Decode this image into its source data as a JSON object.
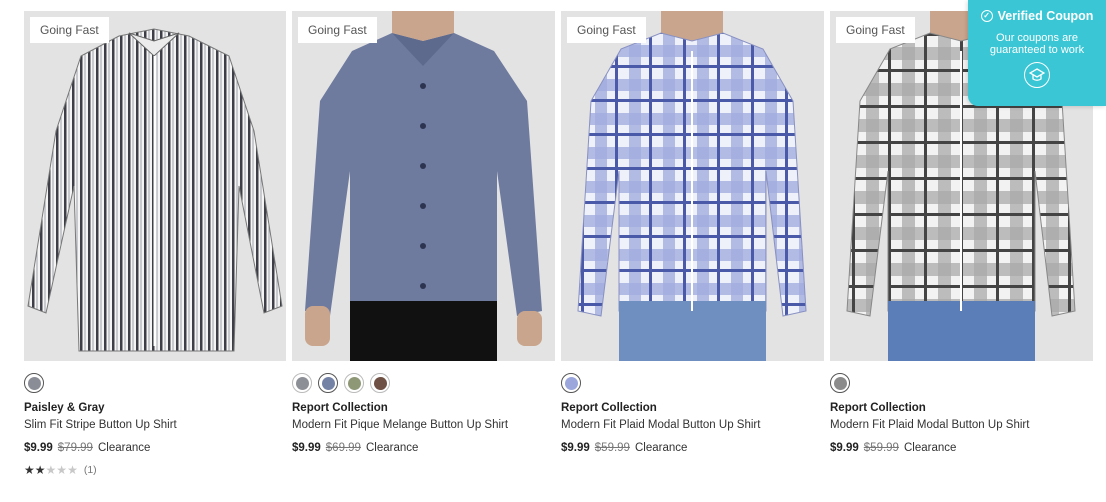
{
  "coupon": {
    "title": "Verified Coupon",
    "line1": "Our coupons are",
    "line2": "guaranteed to work"
  },
  "products": [
    {
      "badge": "Going Fast",
      "brand": "Paisley & Gray",
      "name": "Slim Fit Stripe Button Up Shirt",
      "price": "$9.99",
      "original_price": "$79.99",
      "status": "Clearance",
      "rating": 2,
      "rating_max": 5,
      "rating_count": "(1)",
      "swatches": [
        {
          "color": "#8a8d96",
          "selected": true
        }
      ]
    },
    {
      "badge": "Going Fast",
      "brand": "Report Collection",
      "name": "Modern Fit Pique Melange Button Up Shirt",
      "price": "$9.99",
      "original_price": "$69.99",
      "status": "Clearance",
      "swatches": [
        {
          "color": "#8d8f96",
          "selected": false
        },
        {
          "color": "#7482a6",
          "selected": true
        },
        {
          "color": "#8e9877",
          "selected": false
        },
        {
          "color": "#6e5044",
          "selected": false
        }
      ]
    },
    {
      "badge": "Going Fast",
      "brand": "Report Collection",
      "name": "Modern Fit Plaid Modal Button Up Shirt",
      "price": "$9.99",
      "original_price": "$59.99",
      "status": "Clearance",
      "swatches": [
        {
          "color": "#9aa6dc",
          "selected": true
        }
      ]
    },
    {
      "badge": "Going Fast",
      "brand": "Report Collection",
      "name": "Modern Fit Plaid Modal Button Up Shirt",
      "price": "$9.99",
      "original_price": "$59.99",
      "status": "Clearance",
      "swatches": [
        {
          "color": "#8b8b8b",
          "selected": true
        }
      ]
    }
  ]
}
